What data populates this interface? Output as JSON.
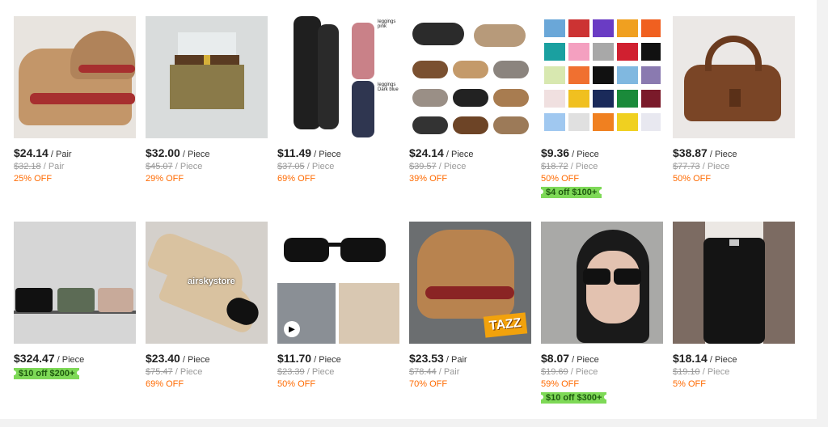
{
  "products": [
    {
      "price": "$24.14",
      "unit": " / Pair",
      "orig": "$32.18",
      "orig_unit": " / Pair",
      "off": "25% OFF",
      "coupon": "",
      "thumb": "boots"
    },
    {
      "price": "$32.00",
      "unit": " / Piece",
      "orig": "$45.07",
      "orig_unit": " / Piece",
      "off": "29% OFF",
      "coupon": "",
      "thumb": "skirt"
    },
    {
      "price": "$11.49",
      "unit": " / Piece",
      "orig": "$37.05",
      "orig_unit": " / Piece",
      "off": "69% OFF",
      "coupon": "",
      "thumb": "leggings"
    },
    {
      "price": "$24.14",
      "unit": " / Piece",
      "orig": "$39.57",
      "orig_unit": " / Piece",
      "off": "39% OFF",
      "coupon": "",
      "thumb": "clogs"
    },
    {
      "price": "$9.36",
      "unit": " / Piece",
      "orig": "$18.72",
      "orig_unit": " / Piece",
      "off": "50% OFF",
      "coupon": "$4 off $100+",
      "thumb": "shorts"
    },
    {
      "price": "$38.87",
      "unit": " / Piece",
      "orig": "$77.73",
      "orig_unit": " / Piece",
      "off": "50% OFF",
      "coupon": "",
      "thumb": "bag"
    },
    {
      "price": "$324.47",
      "unit": " / Piece",
      "orig": "",
      "orig_unit": "",
      "off": "",
      "coupon": "$10 off $200+",
      "thumb": "handbags"
    },
    {
      "price": "$23.40",
      "unit": " / Piece",
      "orig": "$75.47",
      "orig_unit": " / Piece",
      "off": "69% OFF",
      "coupon": "",
      "thumb": "espadrille"
    },
    {
      "price": "$11.70",
      "unit": " / Piece",
      "orig": "$23.39",
      "orig_unit": " / Piece",
      "off": "50% OFF",
      "coupon": "",
      "thumb": "sunglasses"
    },
    {
      "price": "$23.53",
      "unit": " / Pair",
      "orig": "$78.44",
      "orig_unit": " / Pair",
      "off": "70% OFF",
      "coupon": "",
      "thumb": "tazz"
    },
    {
      "price": "$8.07",
      "unit": " / Piece",
      "orig": "$19.69",
      "orig_unit": " / Piece",
      "off": "59% OFF",
      "coupon": "$10 off $300+",
      "thumb": "woman"
    },
    {
      "price": "$18.14",
      "unit": " / Piece",
      "orig": "$19.10",
      "orig_unit": " / Piece",
      "off": "5% OFF",
      "coupon": "",
      "thumb": "pants"
    }
  ],
  "thumb_text": {
    "leggings_pink": "leggings pink",
    "leggings_blue": "leggings Dark blue",
    "airsky": "airskystore",
    "tazz": "TAZZ"
  },
  "colors": {
    "discount": "#ff6a00",
    "coupon_bg": "#7ed957",
    "coupon_text": "#1f5a10"
  }
}
